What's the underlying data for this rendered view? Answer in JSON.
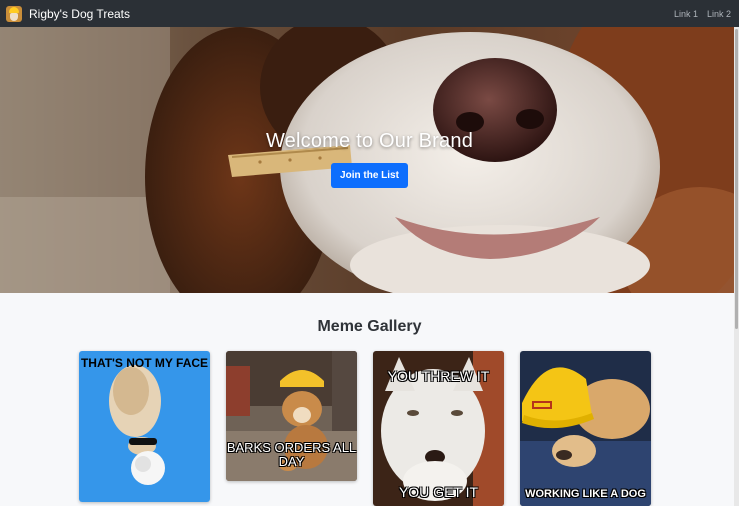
{
  "navbar": {
    "brand": "Rigby's Dog Treats",
    "logo_icon": "dog-logo-icon",
    "links": [
      "Link 1",
      "Link 2"
    ]
  },
  "hero": {
    "title": "Welcome to Our Brand",
    "button": "Join the List",
    "background": "dog-nose-photo",
    "accent": "#0d6efd"
  },
  "gallery": {
    "title": "Meme Gallery",
    "memes": [
      {
        "caption_top": "THAT'S NOT MY FACE",
        "caption_bottom": "",
        "image": "upside-down-dog-photo"
      },
      {
        "caption_top": "",
        "caption_bottom": "BARKS ORDERS ALL DAY",
        "image": "dog-in-hardhat-photo"
      },
      {
        "caption_top": "YOU THREW IT",
        "caption_bottom": "YOU GET IT",
        "image": "white-dog-photo"
      },
      {
        "caption_top": "",
        "caption_bottom": "WORKING LIKE A DOG",
        "image": "dog-in-yellow-hardhat-photo"
      }
    ]
  },
  "colors": {
    "navbar": "#2b3036",
    "page_bg": "#f7f8fa",
    "button": "#0d6efd"
  }
}
